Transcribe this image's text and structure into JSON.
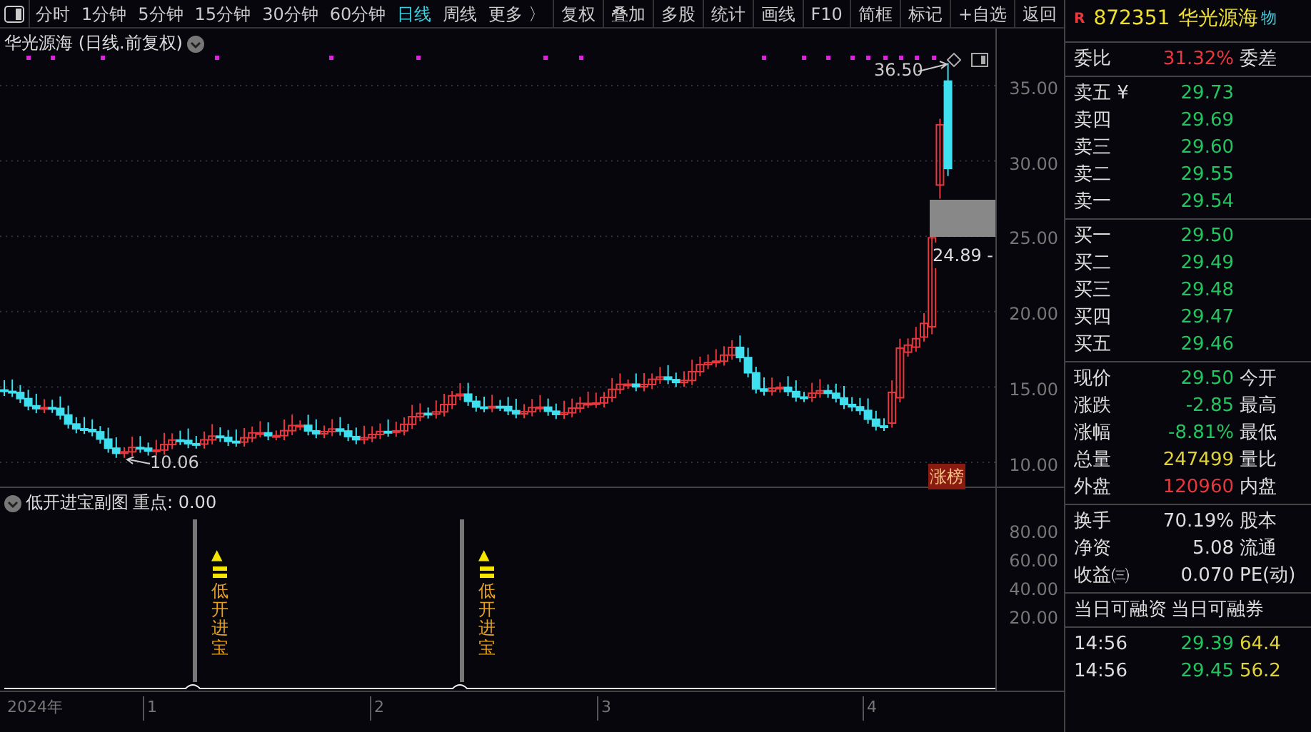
{
  "toolbar": {
    "periods": [
      {
        "label": "分时",
        "selected": false
      },
      {
        "label": "1分钟",
        "selected": false
      },
      {
        "label": "5分钟",
        "selected": false
      },
      {
        "label": "15分钟",
        "selected": false
      },
      {
        "label": "30分钟",
        "selected": false
      },
      {
        "label": "60分钟",
        "selected": false
      },
      {
        "label": "日线",
        "selected": true
      },
      {
        "label": "周线",
        "selected": false
      },
      {
        "label": "更多 〉",
        "selected": false
      }
    ],
    "tools": [
      "复权",
      "叠加",
      "多股",
      "统计",
      "画线",
      "F10",
      "简框",
      "标记",
      "+自选",
      "返回"
    ]
  },
  "chart": {
    "title": "华光源海 (日线.前复权)",
    "yticks": [
      "35.00",
      "30.00",
      "25.00",
      "20.00",
      "15.00",
      "10.00"
    ],
    "high_label": "36.50",
    "current_label": "24.89 -",
    "low_label": "10.06",
    "tag": "涨榜"
  },
  "subchart": {
    "title": "低开进宝副图",
    "value": "重点: 0.00",
    "yticks": [
      "80.00",
      "60.00",
      "40.00",
      "20.00"
    ],
    "signals": [
      {
        "arrow": "▲",
        "text": "低开进宝"
      },
      {
        "arrow": "▲",
        "text": "低开进宝"
      }
    ]
  },
  "xaxis": [
    "2024年",
    "1",
    "2",
    "3",
    "4"
  ],
  "quote": {
    "badge": "R",
    "code": "872351",
    "name": "华光源海",
    "extra": "物",
    "ratio": {
      "label": "委比",
      "value": "31.32%",
      "color": "#e8383d",
      "label2": "委差"
    },
    "asks": [
      {
        "label": "卖五 ¥",
        "price": "29.73"
      },
      {
        "label": "卖四",
        "price": "29.69"
      },
      {
        "label": "卖三",
        "price": "29.60"
      },
      {
        "label": "卖二",
        "price": "29.55"
      },
      {
        "label": "卖一",
        "price": "29.54"
      }
    ],
    "bids": [
      {
        "label": "买一",
        "price": "29.50"
      },
      {
        "label": "买二",
        "price": "29.49"
      },
      {
        "label": "买三",
        "price": "29.48"
      },
      {
        "label": "买四",
        "price": "29.47"
      },
      {
        "label": "买五",
        "price": "29.46"
      }
    ],
    "stats": [
      {
        "label": "现价",
        "value": "29.50",
        "color": "#22c55e",
        "label2": "今开"
      },
      {
        "label": "涨跌",
        "value": "-2.85",
        "color": "#22c55e",
        "label2": "最高"
      },
      {
        "label": "涨幅",
        "value": "-8.81%",
        "color": "#22c55e",
        "label2": "最低"
      },
      {
        "label": "总量",
        "value": "247499",
        "color": "#e0d23a",
        "label2": "量比"
      },
      {
        "label": "外盘",
        "value": "120960",
        "color": "#e8383d",
        "label2": "内盘"
      }
    ],
    "info": [
      {
        "label": "换手",
        "value": "70.19%",
        "label2": "股本"
      },
      {
        "label": "净资",
        "value": "5.08",
        "label2": "流通"
      },
      {
        "label": "收益㈢",
        "value": "0.070",
        "label2": "PE(动)"
      }
    ],
    "margin": [
      "当日可融资",
      "当日可融券"
    ],
    "trades": [
      {
        "time": "14:56",
        "price": "29.39",
        "volume": "64.4"
      },
      {
        "time": "14:56",
        "price": "29.45",
        "volume": "56.2"
      }
    ]
  }
}
